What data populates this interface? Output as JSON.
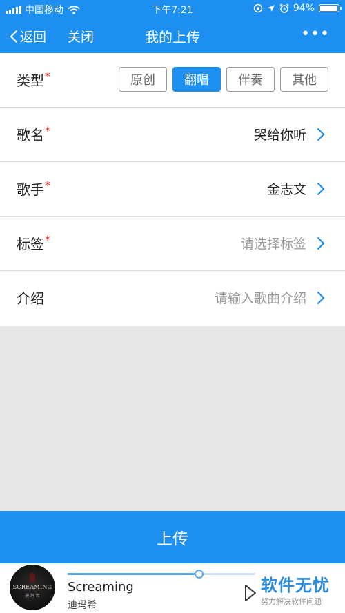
{
  "status_bar": {
    "carrier": "中国移动",
    "time": "下午7:21",
    "battery_text": "94%",
    "battery_level": 0.94
  },
  "nav": {
    "back_label": "返回",
    "close_label": "关闭",
    "title": "我的上传",
    "more_label": "•••"
  },
  "form": {
    "type": {
      "label": "类型",
      "required_mark": "*",
      "options": [
        "原创",
        "翻唱",
        "伴奏",
        "其他"
      ],
      "selected": "翻唱"
    },
    "song_name": {
      "label": "歌名",
      "required_mark": "*",
      "value": "哭给你听"
    },
    "singer": {
      "label": "歌手",
      "required_mark": "*",
      "value": "金志文"
    },
    "tags": {
      "label": "标签",
      "required_mark": "*",
      "placeholder": "请选择标签"
    },
    "intro": {
      "label": "介绍",
      "placeholder": "请输入歌曲介绍"
    }
  },
  "upload_button": {
    "label": "上传"
  },
  "player": {
    "cover_text": "SCREAMING",
    "cover_subtext": "迪 玛 希",
    "song_title": "Screaming",
    "artist": "迪玛希",
    "progress": 0.7
  },
  "watermark": {
    "title": "软件无忧",
    "subtitle": "努力解决软件问题"
  },
  "colors": {
    "accent": "#1c8ff0",
    "required": "#e02020",
    "placeholder": "#999999"
  }
}
